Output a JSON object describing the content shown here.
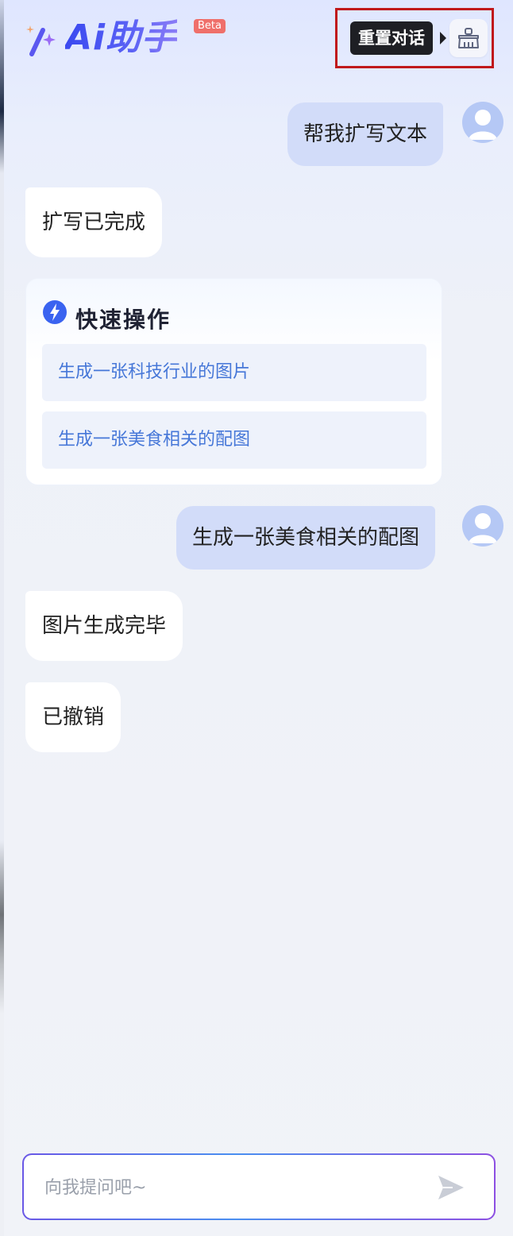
{
  "header": {
    "app_name": "Ai助手",
    "beta_label": "Beta",
    "reset_tooltip": "重置对话",
    "reset_icon": "broom-icon"
  },
  "messages": [
    {
      "role": "user",
      "text": "帮我扩写文本"
    },
    {
      "role": "assistant",
      "text": "扩写已完成"
    },
    {
      "role": "user",
      "text": "生成一张美食相关的配图"
    },
    {
      "role": "assistant",
      "text": "图片生成完毕"
    },
    {
      "role": "assistant",
      "text": "已撤销"
    }
  ],
  "quick_actions": {
    "title": "快速操作",
    "icon": "lightning-icon",
    "items": [
      "生成一张科技行业的图片",
      "生成一张美食相关的配图"
    ]
  },
  "input": {
    "placeholder": "向我提问吧~",
    "value": "",
    "send_icon": "send-icon"
  },
  "colors": {
    "accent": "#4a4df0",
    "user_bubble": "#d2dcf9",
    "link_text": "#4677d8",
    "highlight_border": "#c0191b",
    "beta_badge": "#ef6f6a"
  }
}
